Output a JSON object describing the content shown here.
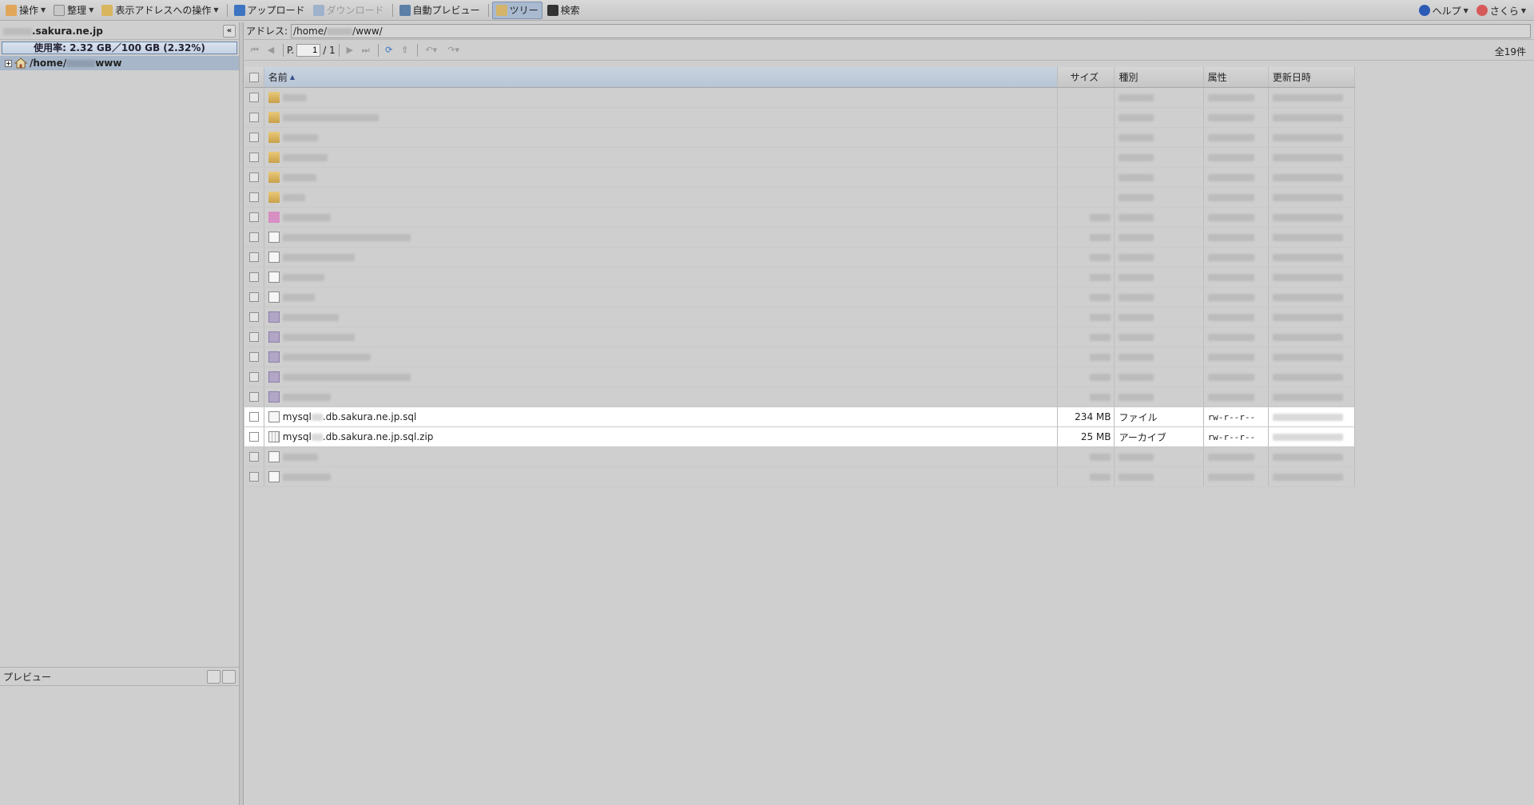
{
  "toolbar": {
    "operation": "操作",
    "organize": "整理",
    "address_ops": "表示アドレスへの操作",
    "upload": "アップロード",
    "download": "ダウンロード",
    "auto_preview": "自動プレビュー",
    "tree": "ツリー",
    "search": "検索",
    "help": "ヘルプ",
    "user": "さくら"
  },
  "sidebar": {
    "domain_suffix": ".sakura.ne.jp",
    "usage": "使用率: 2.32 GB／100 GB (2.32%)",
    "tree_root_prefix": "/home/",
    "tree_root_suffix": "www"
  },
  "preview": {
    "title": "プレビュー"
  },
  "address": {
    "label": "アドレス:",
    "prefix": "/home/",
    "suffix": "/www/"
  },
  "pager": {
    "page_label": "P.",
    "page": "1",
    "of": "/ 1",
    "total": "全19件"
  },
  "grid": {
    "headers": {
      "name": "名前",
      "size": "サイズ",
      "type": "種別",
      "attr": "属性",
      "date": "更新日時"
    },
    "rows": [
      {
        "icon": "folder",
        "name": "",
        "size": "",
        "type": "",
        "attr": "",
        "date": ""
      },
      {
        "icon": "folder",
        "name": "",
        "size": "",
        "type": "",
        "attr": "",
        "date": ""
      },
      {
        "icon": "folder",
        "name": "",
        "size": "",
        "type": "",
        "attr": "",
        "date": ""
      },
      {
        "icon": "folder",
        "name": "",
        "size": "",
        "type": "",
        "attr": "",
        "date": ""
      },
      {
        "icon": "folder",
        "name": "",
        "size": "",
        "type": "",
        "attr": "",
        "date": ""
      },
      {
        "icon": "folder",
        "name": "",
        "size": "",
        "type": "",
        "attr": "",
        "date": ""
      },
      {
        "icon": "pink",
        "name": "",
        "size": "",
        "type": "",
        "attr": "",
        "date": ""
      },
      {
        "icon": "doc",
        "name": "",
        "size": "",
        "type": "",
        "attr": "",
        "date": ""
      },
      {
        "icon": "doc",
        "name": "",
        "size": "",
        "type": "",
        "attr": "",
        "date": ""
      },
      {
        "icon": "doc",
        "name": "",
        "size": "",
        "type": "",
        "attr": "",
        "date": ""
      },
      {
        "icon": "doc",
        "name": "",
        "size": "",
        "type": "",
        "attr": "",
        "date": ""
      },
      {
        "icon": "img",
        "name": "",
        "size": "",
        "type": "",
        "attr": "",
        "date": ""
      },
      {
        "icon": "img",
        "name": "",
        "size": "",
        "type": "",
        "attr": "",
        "date": ""
      },
      {
        "icon": "img",
        "name": "",
        "size": "",
        "type": "",
        "attr": "",
        "date": ""
      },
      {
        "icon": "img",
        "name": "",
        "size": "",
        "type": "",
        "attr": "",
        "date": ""
      },
      {
        "icon": "img",
        "name": "",
        "size": "",
        "type": "",
        "attr": "",
        "date": ""
      },
      {
        "icon": "doc",
        "name_prefix": "mysql",
        "name_suffix": ".db.sakura.ne.jp.sql",
        "size": "234 MB",
        "type": "ファイル",
        "attr": "rw-r--r--",
        "date": "",
        "selected": true
      },
      {
        "icon": "zip",
        "name_prefix": "mysql",
        "name_suffix": ".db.sakura.ne.jp.sql.zip",
        "size": "25 MB",
        "type": "アーカイブ",
        "attr": "rw-r--r--",
        "date": "",
        "selected": true
      },
      {
        "icon": "doc",
        "name": "",
        "size": "",
        "type": "",
        "attr": "",
        "date": ""
      },
      {
        "icon": "doc",
        "name": "",
        "size": "",
        "type": "",
        "attr": "",
        "date": ""
      }
    ]
  }
}
